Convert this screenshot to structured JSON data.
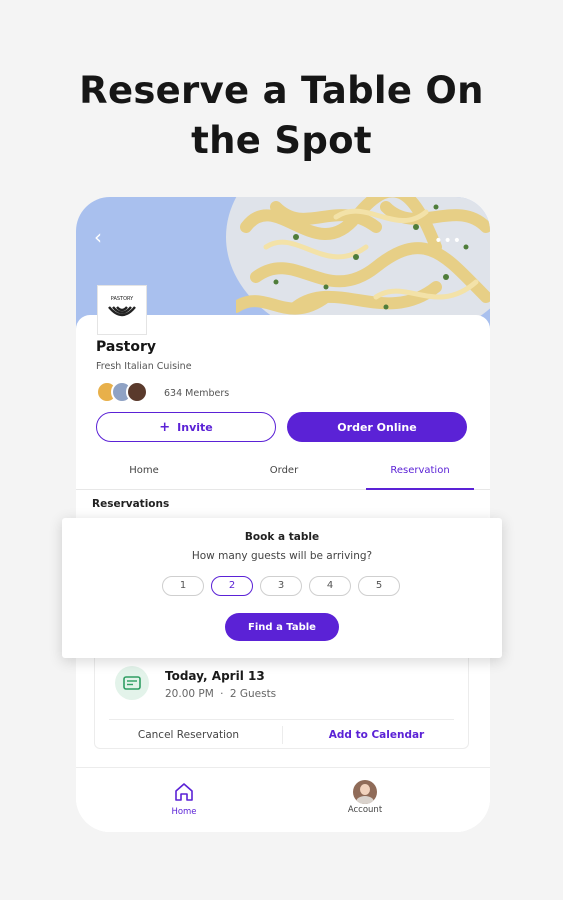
{
  "headline": {
    "line1": "Reserve a Table On",
    "line2": "the Spot"
  },
  "business": {
    "logo_text": "PASTORY",
    "name": "Pastory",
    "tagline": "Fresh Italian Cuisine",
    "members": "634 Members"
  },
  "actions": {
    "invite_label": "Invite",
    "invite_icon": "plus-icon",
    "order_label": "Order Online"
  },
  "tabs": [
    {
      "label": "Home"
    },
    {
      "label": "Order"
    },
    {
      "label": "Reservation",
      "active": true
    }
  ],
  "reservations": {
    "section_title": "Reservations",
    "date": "Today, April 13",
    "time": "20.00 PM",
    "separator": "·",
    "guests": "2 Guests",
    "cancel_label": "Cancel Reservation",
    "calendar_label": "Add to Calendar"
  },
  "booking_sheet": {
    "title": "Book a table",
    "question": "How many guests will be arriving?",
    "options": [
      "1",
      "2",
      "3",
      "4",
      "5"
    ],
    "selected": "2",
    "find_label": "Find a Table"
  },
  "bottom_nav": {
    "home_label": "Home",
    "account_label": "Account"
  },
  "colors": {
    "accent": "#5b22d6",
    "hero_bg": "#a9c0ee",
    "page_bg": "#f4f4f4"
  }
}
